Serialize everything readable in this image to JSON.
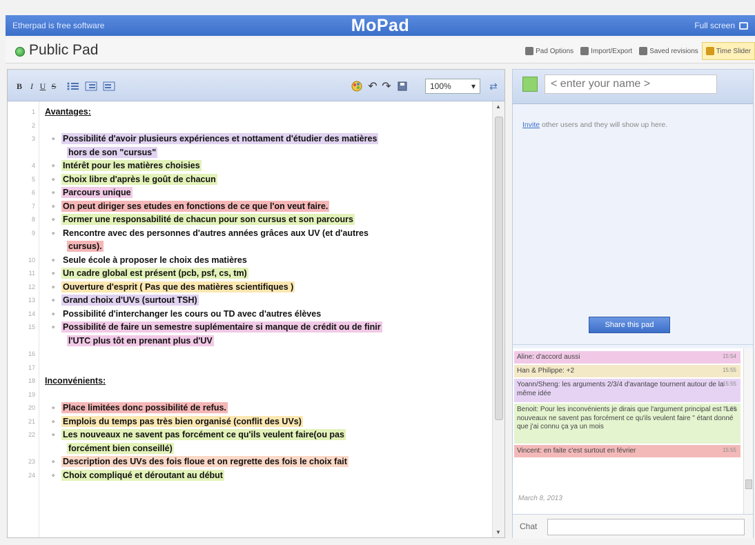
{
  "topbar": {
    "free_software": "Etherpad is free software",
    "app_title": "MoPad",
    "fullscreen": "Full screen"
  },
  "padheader": {
    "pad_name": "Public Pad",
    "pad_options": "Pad Options",
    "import_export": "Import/Export",
    "saved_revisions": "Saved revisions",
    "time_slider": "Time Slider"
  },
  "toolbar": {
    "bold": "B",
    "italic": "I",
    "underline": "U",
    "strikethrough": "S",
    "zoom": "100%"
  },
  "editor": {
    "lines": [
      {
        "n": "1",
        "type": "head",
        "text": "Avantages:",
        "c": "none"
      },
      {
        "n": "2",
        "type": "blank",
        "text": "",
        "c": "none"
      },
      {
        "n": "3",
        "type": "item",
        "text": "Possibilité d'avoir plusieurs expériences et nottament d'étudier des matières",
        "c": "purple"
      },
      {
        "n": "",
        "type": "cont",
        "text": "hors de son \"cursus\"",
        "c": "purple"
      },
      {
        "n": "4",
        "type": "item",
        "text": "Intérêt pour les matières choisies",
        "c": "green"
      },
      {
        "n": "5",
        "type": "item",
        "text": "Choix libre d'après le goût de chacun",
        "c": "green"
      },
      {
        "n": "6",
        "type": "item",
        "text": "Parcours unique",
        "c": "pink"
      },
      {
        "n": "7",
        "type": "item",
        "text": "On peut diriger ses etudes en fonctions de ce que l'on veut faire.",
        "c": "red"
      },
      {
        "n": "8",
        "type": "item",
        "text": "Former une responsabilité de chacun pour son cursus et son parcours",
        "c": "green"
      },
      {
        "n": "9",
        "type": "item",
        "text": "Rencontre avec des personnes d'autres années grâces aux UV (et d'autres",
        "c": "none"
      },
      {
        "n": "",
        "type": "cont",
        "text": "cursus).",
        "c": "red"
      },
      {
        "n": "10",
        "type": "item",
        "text": "Seule école à proposer le choix des matières",
        "c": "none"
      },
      {
        "n": "11",
        "type": "item",
        "text": "Un cadre global est présent (pcb, psf, cs, tm)",
        "c": "green"
      },
      {
        "n": "12",
        "type": "item",
        "text": "Ouverture d'esprit ( Pas que des matières scientifiques )",
        "c": "yellow"
      },
      {
        "n": "13",
        "type": "item",
        "text": "Grand choix d'UVs (surtout TSH)",
        "c": "purple"
      },
      {
        "n": "14",
        "type": "item",
        "text": "Possibilité d'interchanger les cours ou TD avec d'autres élèves",
        "c": "none"
      },
      {
        "n": "15",
        "type": "item",
        "text": "Possibilité de faire un semestre suplémentaire si manque de crédit ou de finir",
        "c": "pink"
      },
      {
        "n": "",
        "type": "cont",
        "text": "l'UTC plus tôt en prenant plus d'UV",
        "c": "pink"
      },
      {
        "n": "16",
        "type": "blank",
        "text": "",
        "c": "none"
      },
      {
        "n": "17",
        "type": "blank",
        "text": "",
        "c": "none"
      },
      {
        "n": "18",
        "type": "head",
        "text": "Inconvénients:",
        "c": "none"
      },
      {
        "n": "19",
        "type": "blank",
        "text": "",
        "c": "none"
      },
      {
        "n": "20",
        "type": "item",
        "text": "Place limitées donc possibilité de refus.",
        "c": "red"
      },
      {
        "n": "21",
        "type": "item",
        "text": "Emplois du temps pas très bien organisé (conflit des UVs)",
        "c": "yellow"
      },
      {
        "n": "22",
        "type": "item",
        "text": "Les nouveaux ne savent pas forcément ce qu'ils veulent faire(ou pas",
        "c": "green"
      },
      {
        "n": "",
        "type": "cont",
        "text": "forcément bien conseillé)",
        "c": "green"
      },
      {
        "n": "23",
        "type": "item",
        "text": "Description des UVs des fois floue et on regrette des fois le choix fait",
        "c": "peach"
      },
      {
        "n": "24",
        "type": "item",
        "text": "Choix compliqué et déroutant au début",
        "c": "green"
      }
    ]
  },
  "side": {
    "name_placeholder": "< enter your name >",
    "invite_link": "Invite",
    "invite_text": " other users and they will show up here.",
    "share_button": "Share this pad",
    "messages": [
      {
        "author": "Aline",
        "text": ": d'accord aussi",
        "time": "15:54"
      },
      {
        "author": "Han & Philippe",
        "text": ": +2",
        "time": "15:55"
      },
      {
        "author": "Yoann/Sheng",
        "text": ": les arguments 2/3/4 d'avantage tournent autour de la même idée",
        "time": "15:55"
      },
      {
        "author": "Benoit",
        "text": ": Pour les inconvénients je dirais que l'argument principal est \"Les nouveaux ne savent pas forcément ce qu'ils veulent faire \" étant donné que j'ai connu ça ya un mois",
        "time": "15:55"
      },
      {
        "author": "Vincent",
        "text": ": en faite c'est surtout en février",
        "time": "15:55"
      }
    ],
    "date": "March 8, 2013",
    "chat_label": "Chat"
  },
  "colors": {
    "topbar": "#3b6fc9",
    "name_text": "#e2421f"
  }
}
